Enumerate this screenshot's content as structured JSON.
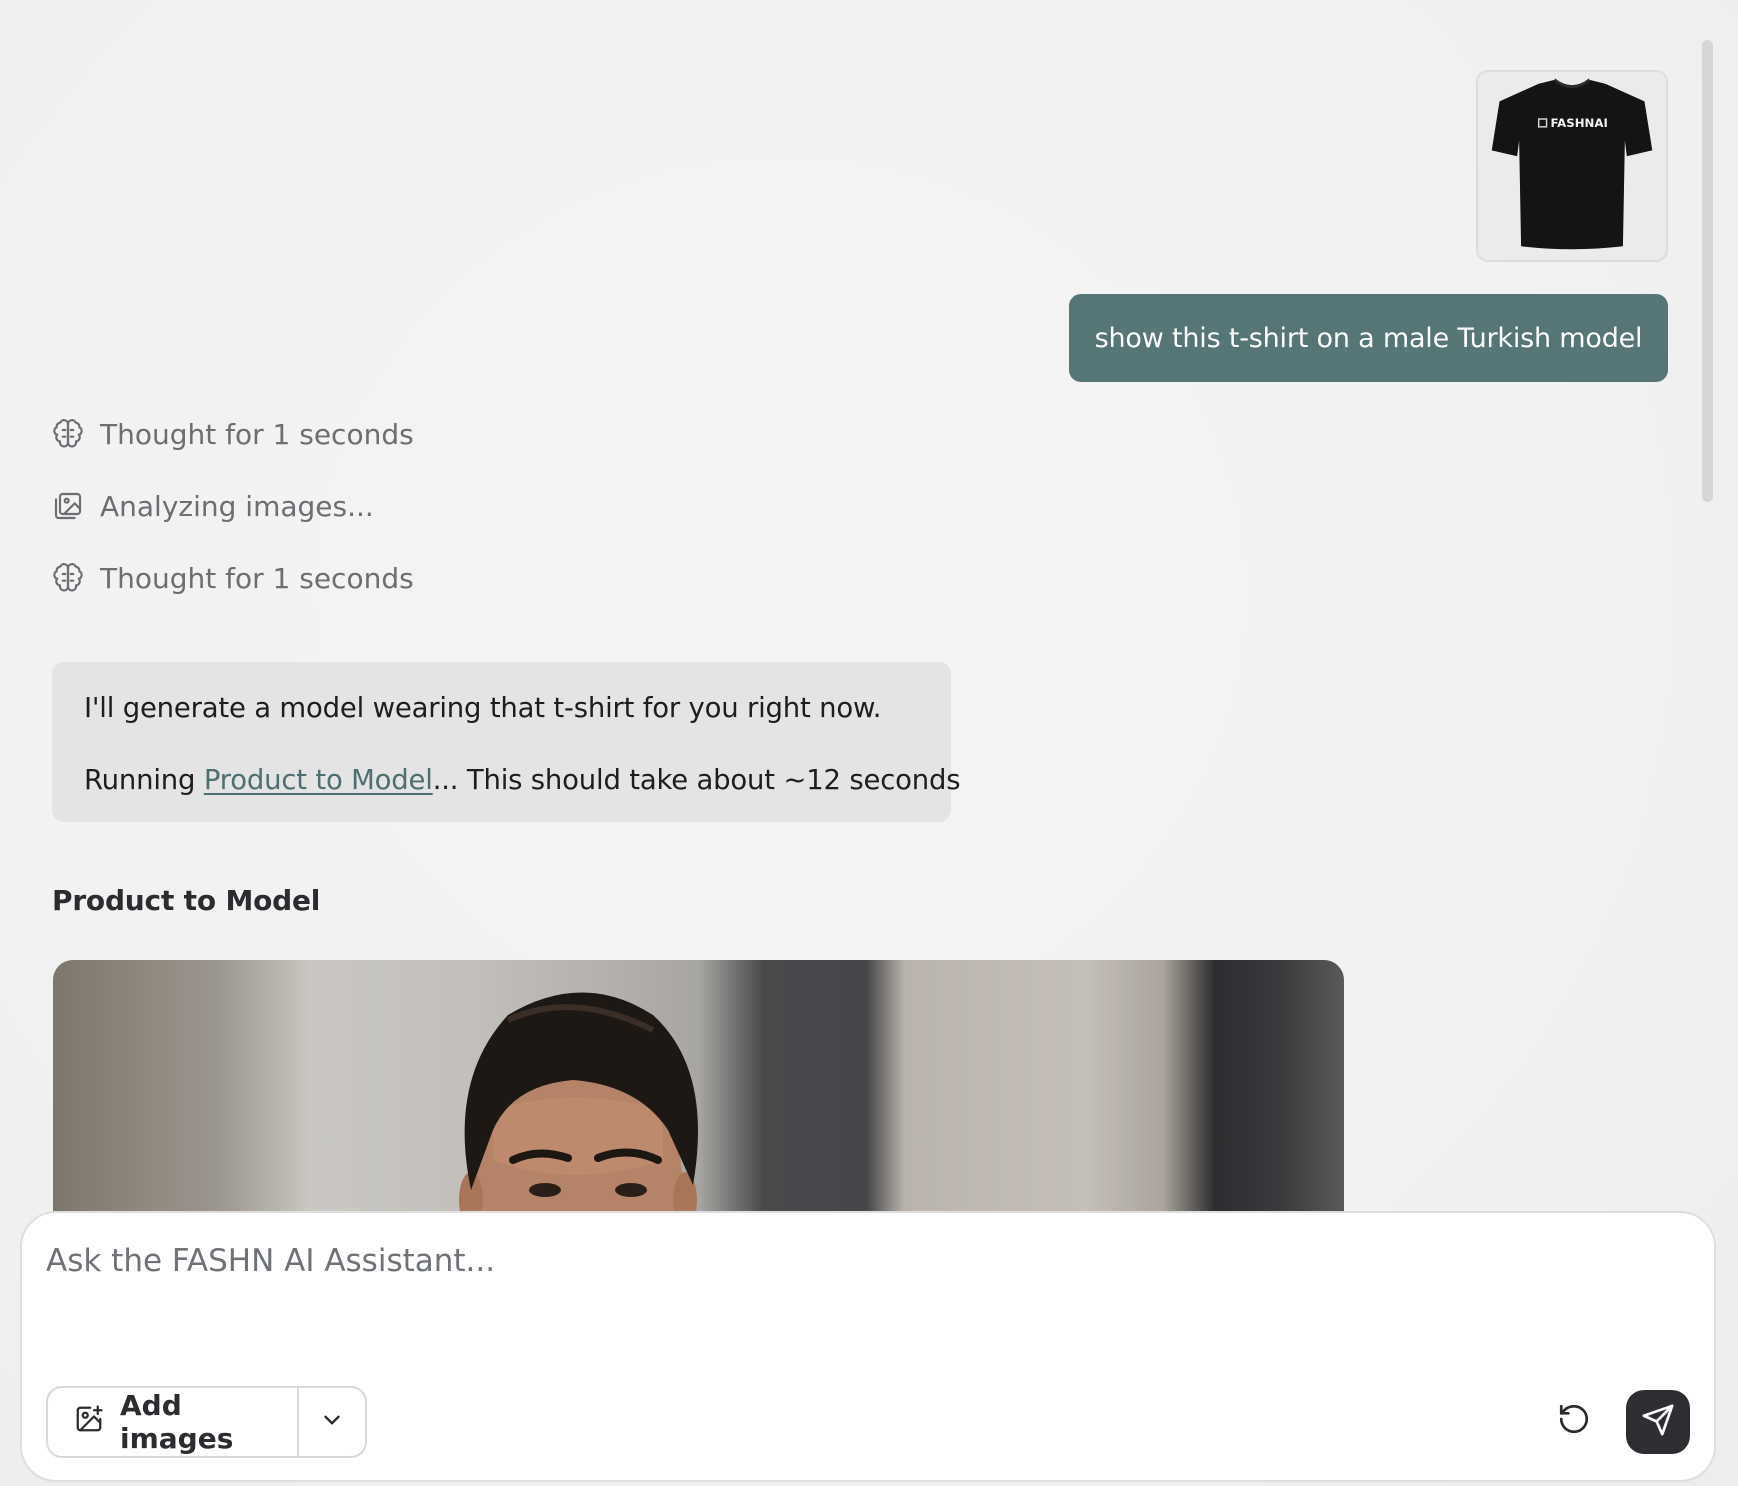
{
  "conversation": {
    "user_message": {
      "image_icon": "tshirt-thumbnail-icon",
      "image_logo_text": "FASHNAI",
      "text": "show this t-shirt on a male Turkish model"
    },
    "status_steps": [
      {
        "icon": "brain-icon",
        "label": "Thought for 1 seconds"
      },
      {
        "icon": "images-icon",
        "label": "Analyzing images..."
      },
      {
        "icon": "brain-icon",
        "label": "Thought for 1 seconds"
      }
    ],
    "assistant_message": {
      "line1": "I'll generate a model wearing that t-shirt for you right now.",
      "line2_prefix": "Running ",
      "line2_link": "Product to Model",
      "line2_suffix": "... This should take about ~12 seconds"
    },
    "result": {
      "title": "Product to Model",
      "image_icon": "generated-model-photo"
    }
  },
  "composer": {
    "placeholder": "Ask the FASHN AI Assistant...",
    "add_images_label": "Add images",
    "add_images_icon": "image-plus-icon",
    "dropdown_icon": "chevron-down-icon",
    "reset_icon": "rotate-ccw-icon",
    "send_icon": "send-icon"
  },
  "colors": {
    "user_bubble": "#567577",
    "assistant_bubble": "#e4e4e5",
    "link": "#4d6f71",
    "send_button": "#2c2e31"
  }
}
